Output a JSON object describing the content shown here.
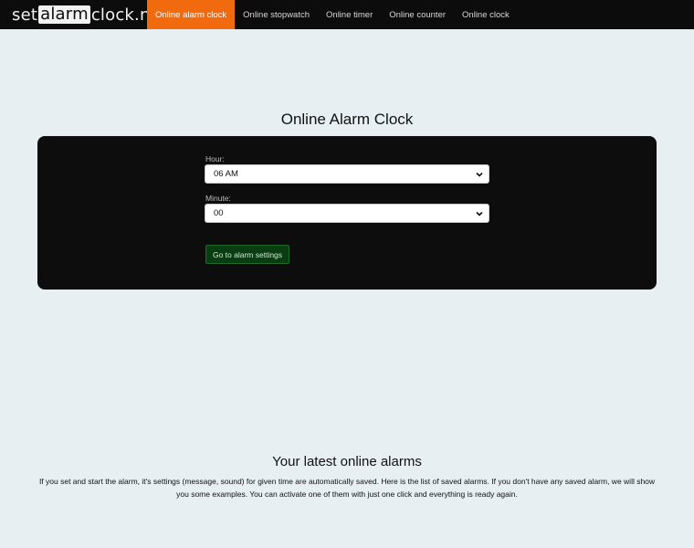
{
  "logo": {
    "prefix": "set",
    "boxed": "alarm",
    "suffix": "clock.net"
  },
  "nav": {
    "items": [
      {
        "label": "Online alarm clock",
        "active": true
      },
      {
        "label": "Online stopwatch",
        "active": false
      },
      {
        "label": "Online timer",
        "active": false
      },
      {
        "label": "Online counter",
        "active": false
      },
      {
        "label": "Online clock",
        "active": false
      }
    ]
  },
  "main": {
    "title": "Online Alarm Clock",
    "hour": {
      "label": "Hour:",
      "value": "06 AM"
    },
    "minute": {
      "label": "Minute:",
      "value": "00"
    },
    "go_button_label": "Go to alarm settings"
  },
  "latest": {
    "title": "Your latest online alarms",
    "text": "If you set and start the alarm, it's settings (message, sound) for given time are automatically saved. Here is the list of saved alarms. If you don't have any saved alarm, we will show you some examples. You can activate one of them with just one click and everything is ready again."
  },
  "colors": {
    "navbar": "#0c0c0c",
    "active_tab": "#f26a0e",
    "page_background": "#e8eff2",
    "panel": "#0d0d0d",
    "go_button": "#0b3d12"
  },
  "icons": {
    "select_arrow": "chevron-down-icon"
  }
}
